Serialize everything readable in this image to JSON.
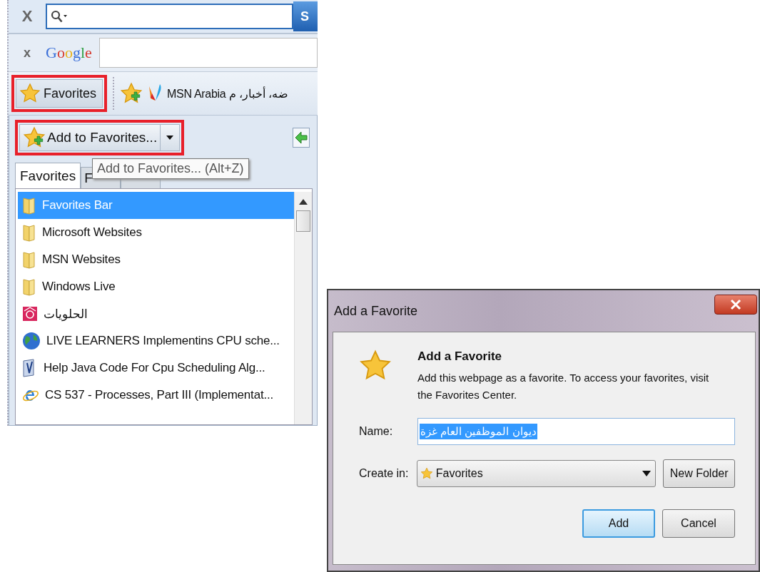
{
  "search_bar": {
    "close": "X",
    "button": "S"
  },
  "google_bar": {
    "close": "x",
    "logo": "Google"
  },
  "favorites_bar": {
    "favorites_button": "Favorites",
    "link": "MSN Arabia ضه، أخبار، م"
  },
  "panel": {
    "add_button": "Add to Favorites...",
    "tooltip": "Add to Favorites... (Alt+Z)",
    "tabs": [
      {
        "label": "Favorites",
        "selected": true
      },
      {
        "label": "F",
        "selected": false
      },
      {
        "selected": false
      }
    ],
    "items": [
      {
        "kind": "folder",
        "label": "Favorites Bar",
        "selected": true
      },
      {
        "kind": "folder",
        "label": "Microsoft Websites",
        "selected": false
      },
      {
        "kind": "folder",
        "label": "MSN Websites",
        "selected": false
      },
      {
        "kind": "folder",
        "label": "Windows Live",
        "selected": false
      },
      {
        "kind": "site",
        "label": "الحلويات",
        "selected": false
      },
      {
        "kind": "globe",
        "label": "LIVE LEARNERS Implementins CPU sche...",
        "selected": false
      },
      {
        "kind": "page",
        "label": "Help Java Code For Cpu Scheduling Alg...",
        "selected": false
      },
      {
        "kind": "browser",
        "label": "CS 537 - Processes, Part III (Implementat...",
        "selected": false
      }
    ]
  },
  "dialog": {
    "title": "Add a Favorite",
    "heading": "Add a Favorite",
    "description": "Add this webpage as a favorite. To access your favorites, visit the Favorites Center.",
    "name_label": "Name:",
    "name_value": "ديوان الموظفين العام غزة",
    "create_label": "Create in:",
    "create_value": "Favorites",
    "new_folder": "New Folder",
    "add": "Add",
    "cancel": "Cancel"
  }
}
